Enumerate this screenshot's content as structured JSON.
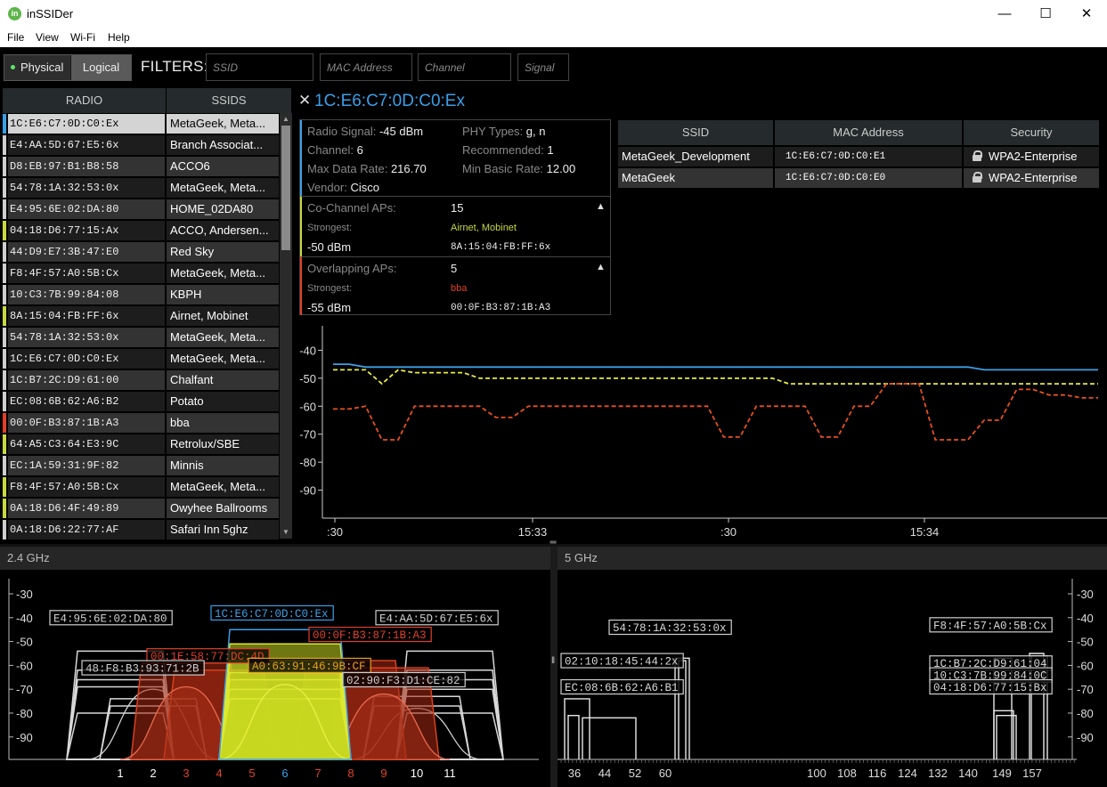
{
  "window": {
    "title": "inSSIDer",
    "icon_letter": "in",
    "minimize": "—",
    "maximize": "☐",
    "close": "✕"
  },
  "menu": [
    "File",
    "View",
    "Wi-Fi",
    "Help"
  ],
  "mode": {
    "physical": "Physical",
    "logical": "Logical",
    "active": "physical"
  },
  "filters": {
    "label": "FILTERS:",
    "ssid_placeholder": "SSID",
    "mac_placeholder": "MAC Address",
    "channel_placeholder": "Channel",
    "signal_placeholder": "Signal"
  },
  "radio_table": {
    "headers": [
      "RADIO",
      "SSIDS"
    ],
    "rows": [
      {
        "mac": "1C:E6:C7:0D:C0:Ex",
        "ssids": "MetaGeek, Meta...",
        "color": "#3b9fe8",
        "selected": true
      },
      {
        "mac": "E4:AA:5D:67:E5:6x",
        "ssids": "Branch Associat...",
        "color": "#cfcfcf"
      },
      {
        "mac": "D8:EB:97:B1:B8:58",
        "ssids": "ACCO6",
        "color": "#cfcfcf"
      },
      {
        "mac": "54:78:1A:32:53:0x",
        "ssids": "MetaGeek, Meta...",
        "color": "#cfcfcf"
      },
      {
        "mac": "E4:95:6E:02:DA:80",
        "ssids": "HOME_02DA80",
        "color": "#cfcfcf"
      },
      {
        "mac": "04:18:D6:77:15:Ax",
        "ssids": "ACCO, Andersen...",
        "color": "#c8d840"
      },
      {
        "mac": "44:D9:E7:3B:47:E0",
        "ssids": "Red Sky",
        "color": "#cfcfcf"
      },
      {
        "mac": "F8:4F:57:A0:5B:Cx",
        "ssids": "MetaGeek, Meta...",
        "color": "#cfcfcf"
      },
      {
        "mac": "10:C3:7B:99:84:08",
        "ssids": "KBPH",
        "color": "#cfcfcf"
      },
      {
        "mac": "8A:15:04:FB:FF:6x",
        "ssids": "Airnet, Mobinet",
        "color": "#c8d840"
      },
      {
        "mac": "54:78:1A:32:53:0x",
        "ssids": "MetaGeek, Meta...",
        "color": "#cfcfcf"
      },
      {
        "mac": "1C:E6:C7:0D:C0:Ex",
        "ssids": "MetaGeek, Meta...",
        "color": "#cfcfcf"
      },
      {
        "mac": "1C:B7:2C:D9:61:00",
        "ssids": "Chalfant",
        "color": "#cfcfcf"
      },
      {
        "mac": "EC:08:6B:62:A6:B2",
        "ssids": "Potato",
        "color": "#cfcfcf"
      },
      {
        "mac": "00:0F:B3:87:1B:A3",
        "ssids": "bba",
        "color": "#e0402a"
      },
      {
        "mac": "64:A5:C3:64:E3:9C",
        "ssids": "Retrolux/SBE",
        "color": "#c8d840"
      },
      {
        "mac": "EC:1A:59:31:9F:82",
        "ssids": "Minnis",
        "color": "#cfcfcf"
      },
      {
        "mac": "F8:4F:57:A0:5B:Cx",
        "ssids": "MetaGeek, Meta...",
        "color": "#c8d840"
      },
      {
        "mac": "0A:18:D6:4F:49:89",
        "ssids": "Owyhee Ballrooms",
        "color": "#c8d840"
      },
      {
        "mac": "0A:18:D6:22:77:AF",
        "ssids": "Safari Inn 5ghz",
        "color": "#cfcfcf"
      }
    ]
  },
  "details": {
    "close": "✕",
    "title": "1C:E6:C7:0D:C0:Ex",
    "radio_signal_label": "Radio Signal:",
    "radio_signal": "-45 dBm",
    "channel_label": "Channel:",
    "channel": "6",
    "max_rate_label": "Max Data Rate:",
    "max_rate": "216.70",
    "vendor_label": "Vendor:",
    "vendor": "Cisco",
    "phy_label": "PHY Types:",
    "phy": "g, n",
    "recommended_label": "Recommended:",
    "recommended": "1",
    "min_rate_label": "Min Basic Rate:",
    "min_rate": "12.00",
    "co_channel": {
      "label": "Co-Channel APs:",
      "count": "15",
      "strongest_label": "Strongest:",
      "ssid": "Airnet, Mobinet",
      "dbm": "-50 dBm",
      "mac": "8A:15:04:FB:FF:6x",
      "arrow": "▲"
    },
    "overlapping": {
      "label": "Overlapping APs:",
      "count": "5",
      "strongest_label": "Strongest:",
      "ssid": "bba",
      "dbm": "-55 dBm",
      "mac": "00:0F:B3:87:1B:A3",
      "arrow": "▲"
    }
  },
  "ssid_table": {
    "headers": [
      "SSID",
      "MAC Address",
      "Security"
    ],
    "rows": [
      {
        "ssid": "MetaGeek_Development",
        "mac": "1C:E6:C7:0D:C0:E1",
        "security": "WPA2-Enterprise"
      },
      {
        "ssid": "MetaGeek",
        "mac": "1C:E6:C7:0D:C0:E0",
        "security": "WPA2-Enterprise"
      }
    ]
  },
  "spectrum": {
    "band24_label": "2.4 GHz",
    "band5_label": "5 GHz",
    "y_ticks": [
      -30,
      -40,
      -50,
      -60,
      -70,
      -80,
      -90
    ],
    "channels24": [
      {
        "label": "1",
        "color": "#ffffff"
      },
      {
        "label": "2",
        "color": "#ffffff"
      },
      {
        "label": "3",
        "color": "#e0402a"
      },
      {
        "label": "4",
        "color": "#e0402a"
      },
      {
        "label": "5",
        "color": "#e0402a"
      },
      {
        "label": "6",
        "color": "#3b9fe8"
      },
      {
        "label": "7",
        "color": "#e0402a"
      },
      {
        "label": "8",
        "color": "#e0402a"
      },
      {
        "label": "9",
        "color": "#e0402a"
      },
      {
        "label": "10",
        "color": "#ffffff"
      },
      {
        "label": "11",
        "color": "#ffffff"
      }
    ],
    "channels5": [
      "36",
      "44",
      "52",
      "60",
      "100",
      "108",
      "116",
      "124",
      "132",
      "140",
      "149",
      "157"
    ],
    "labels24": [
      {
        "text": "E4:95:6E:02:DA:80",
        "color": "#cfcfcf"
      },
      {
        "text": "1C:E6:C7:0D:C0:Ex",
        "color": "#3b9fe8"
      },
      {
        "text": "E4:AA:5D:67:E5:6x",
        "color": "#cfcfcf"
      },
      {
        "text": "00:0F:B3:87:1B:A3",
        "color": "#e0402a"
      },
      {
        "text": "00:1E:58:77:DC:4D",
        "color": "#e0402a"
      },
      {
        "text": "A0:63:91:46:9B:CF",
        "color": "#e8a020"
      },
      {
        "text": "48:F8:B3:93:71:2B",
        "color": "#cfcfcf"
      },
      {
        "text": "02:90:F3:D1:CE:82",
        "color": "#cfcfcf"
      }
    ],
    "labels5": [
      {
        "text": "54:78:1A:32:53:0x"
      },
      {
        "text": "02:10:18:45:44:2x"
      },
      {
        "text": "EC:08:6B:62:A6:B1"
      },
      {
        "text": "F8:4F:57:A0:5B:Cx"
      },
      {
        "text": "1C:B7:2C:D9:61:04"
      },
      {
        "text": "10:C3:7B:99:84:0C"
      },
      {
        "text": "04:18:D6:77:15:Bx"
      }
    ]
  },
  "chart_data": {
    "type": "line",
    "ylabel": "",
    "ylim": [
      -100,
      -30
    ],
    "y_ticks": [
      -40,
      -50,
      -60,
      -70,
      -80,
      -90
    ],
    "x_ticks": [
      ":30",
      "15:33",
      ":30",
      "15:34"
    ],
    "series": [
      {
        "color": "#3b9fe8",
        "style": "solid",
        "values": [
          -45,
          -45,
          -46,
          -46,
          -46,
          -46,
          -46,
          -46,
          -46,
          -46,
          -46,
          -46,
          -46,
          -46,
          -46,
          -46,
          -46,
          -46,
          -46,
          -46,
          -46,
          -46,
          -46,
          -46,
          -46,
          -46,
          -46,
          -46,
          -46,
          -46,
          -46,
          -46,
          -46,
          -46,
          -46,
          -46,
          -46,
          -46,
          -46,
          -46,
          -47,
          -47,
          -47,
          -47,
          -47,
          -47,
          -47,
          -47
        ]
      },
      {
        "color": "#e8ec40",
        "style": "dashed",
        "values": [
          -47,
          -47,
          -47,
          -52,
          -47,
          -48,
          -48,
          -48,
          -48,
          -50,
          -50,
          -50,
          -50,
          -50,
          -50,
          -50,
          -50,
          -50,
          -50,
          -50,
          -50,
          -50,
          -50,
          -50,
          -50,
          -50,
          -50,
          -50,
          -52,
          -52,
          -52,
          -52,
          -52,
          -52,
          -52,
          -52,
          -52,
          -52,
          -52,
          -52,
          -52,
          -52,
          -52,
          -52,
          -52,
          -52,
          -52,
          -52
        ]
      },
      {
        "color": "#e8501e",
        "style": "dashed",
        "values": [
          -61,
          -61,
          -60,
          -72,
          -72,
          -60,
          -60,
          -60,
          -60,
          -60,
          -64,
          -64,
          -60,
          -60,
          -60,
          -60,
          -60,
          -60,
          -60,
          -60,
          -60,
          -60,
          -60,
          -60,
          -71,
          -71,
          -60,
          -60,
          -60,
          -60,
          -71,
          -71,
          -60,
          -60,
          -52,
          -52,
          -52,
          -72,
          -72,
          -72,
          -65,
          -65,
          -54,
          -54,
          -56,
          -56,
          -57,
          -57
        ]
      }
    ]
  }
}
